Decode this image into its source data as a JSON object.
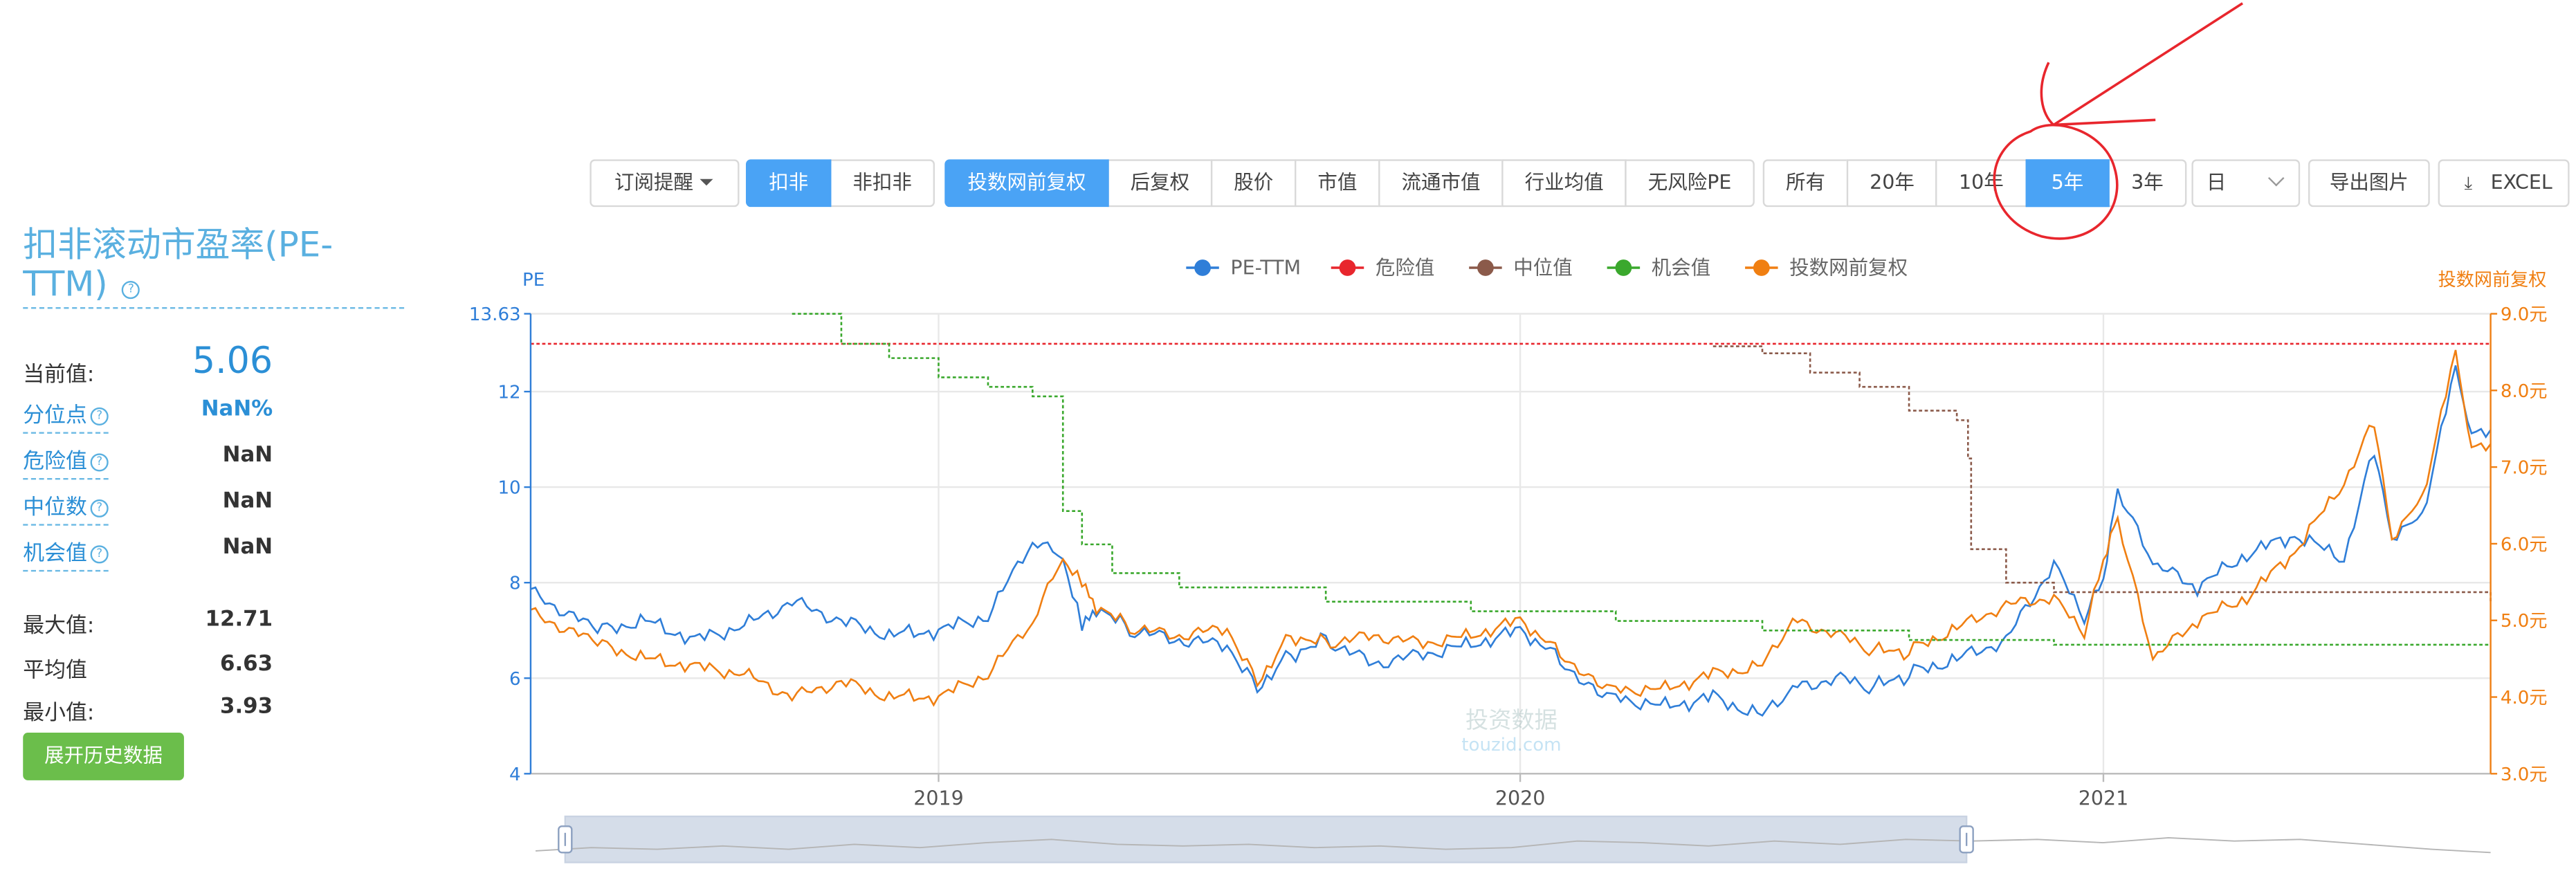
{
  "toolbar": {
    "subscribe": "订阅提醒",
    "group1": [
      "扣非",
      "非扣非"
    ],
    "group2": [
      "投数网前复权",
      "后复权",
      "股价",
      "市值",
      "流通市值",
      "行业均值",
      "无风险PE"
    ],
    "group3": [
      "所有",
      "20年",
      "10年",
      "5年",
      "3年"
    ],
    "period_select": "日",
    "export_image": "导出图片",
    "export_excel": "EXCEL"
  },
  "left_panel": {
    "title": "扣非滚动市盈率(PE-TTM)",
    "current_label": "当前值:",
    "current_value": "5.06",
    "percentile_label": "分位点",
    "percentile_value": "NaN%",
    "danger_label": "危险值",
    "danger_value": "NaN",
    "median_label": "中位数",
    "median_value": "NaN",
    "chance_label": "机会值",
    "chance_value": "NaN",
    "max_label": "最大值:",
    "max_value": "12.71",
    "avg_label": "平均值",
    "avg_value": "6.63",
    "min_label": "最小值:",
    "min_value": "3.93",
    "history_button": "展开历史数据"
  },
  "colors": {
    "pe": "#2f7ed8",
    "danger": "#e8262d",
    "median": "#8b5a4a",
    "chance": "#3aa82d",
    "price": "#f07f12",
    "active": "#4aa3f5",
    "annotation": "#e8262d"
  },
  "chart_data": {
    "type": "line",
    "title": "",
    "ylabel_left": "PE",
    "ylabel_right": "投数网前复权",
    "ylim_left": [
      4,
      13.63
    ],
    "yticks_left": [
      "4",
      "6",
      "8",
      "10",
      "12",
      "13.63"
    ],
    "ylim_right": [
      3.0,
      9.0
    ],
    "yticks_right": [
      "3.0元",
      "4.0元",
      "5.0元",
      "6.0元",
      "7.0元",
      "8.0元",
      "9.0元"
    ],
    "xlim": [
      "2018-04-20",
      "2021-09-01"
    ],
    "xticks": [
      "2019",
      "2020",
      "2021"
    ],
    "watermark": [
      "投资数据",
      "touzid.com"
    ],
    "legend": [
      "PE-TTM",
      "危险值",
      "中位值",
      "机会值",
      "投数网前复权"
    ],
    "legend_position": "top-center",
    "grid": true,
    "series": [
      {
        "name": "PE-TTM",
        "axis": "left",
        "x": [
          "2018-04-20",
          "2018-06-01",
          "2018-07-01",
          "2018-08-01",
          "2018-09-01",
          "2018-10-01",
          "2018-11-01",
          "2018-12-01",
          "2019-01-01",
          "2019-02-01",
          "2019-03-01",
          "2019-03-20",
          "2019-04-01",
          "2019-04-10",
          "2019-05-01",
          "2019-06-01",
          "2019-07-01",
          "2019-07-20",
          "2019-08-10",
          "2019-09-01",
          "2019-10-01",
          "2019-11-01",
          "2019-12-01",
          "2020-01-01",
          "2020-01-20",
          "2020-02-10",
          "2020-03-01",
          "2020-04-01",
          "2020-05-01",
          "2020-06-01",
          "2020-06-20",
          "2020-07-20",
          "2020-08-10",
          "2020-09-01",
          "2020-10-01",
          "2020-11-01",
          "2020-12-01",
          "2020-12-20",
          "2021-01-01",
          "2021-01-10",
          "2021-02-01",
          "2021-03-01",
          "2021-04-01",
          "2021-05-01",
          "2021-06-01",
          "2021-06-20",
          "2021-07-01",
          "2021-07-20",
          "2021-08-10",
          "2021-08-20",
          "2021-09-01"
        ],
        "values": [
          7.8,
          7.0,
          7.2,
          6.8,
          7.1,
          7.6,
          7.2,
          6.9,
          7.0,
          7.3,
          8.9,
          8.5,
          7.1,
          7.5,
          7.0,
          6.8,
          6.7,
          5.8,
          6.5,
          6.8,
          6.3,
          6.5,
          6.7,
          7.0,
          6.6,
          5.9,
          5.6,
          5.4,
          5.6,
          5.2,
          5.8,
          6.0,
          5.8,
          6.1,
          6.4,
          6.8,
          8.4,
          7.2,
          8.1,
          9.9,
          8.4,
          7.9,
          8.6,
          9.0,
          8.5,
          10.8,
          9.0,
          9.4,
          12.5,
          11.2,
          11.2
        ]
      },
      {
        "name": "投数网前复权",
        "axis": "right",
        "x": [
          "2018-04-20",
          "2018-06-01",
          "2018-07-01",
          "2018-08-01",
          "2018-09-01",
          "2018-10-01",
          "2018-11-01",
          "2018-12-01",
          "2019-01-01",
          "2019-02-01",
          "2019-03-01",
          "2019-03-20",
          "2019-04-01",
          "2019-04-10",
          "2019-05-01",
          "2019-06-01",
          "2019-07-01",
          "2019-07-20",
          "2019-08-10",
          "2019-09-01",
          "2019-10-01",
          "2019-11-01",
          "2019-12-01",
          "2020-01-01",
          "2020-01-20",
          "2020-02-10",
          "2020-03-01",
          "2020-04-01",
          "2020-05-01",
          "2020-06-01",
          "2020-06-20",
          "2020-07-20",
          "2020-08-10",
          "2020-09-01",
          "2020-10-01",
          "2020-11-01",
          "2020-12-01",
          "2020-12-20",
          "2021-01-01",
          "2021-01-10",
          "2021-02-01",
          "2021-03-01",
          "2021-04-01",
          "2021-05-01",
          "2021-06-01",
          "2021-06-20",
          "2021-07-01",
          "2021-07-20",
          "2021-08-10",
          "2021-08-20",
          "2021-09-01"
        ],
        "values": [
          5.1,
          4.7,
          4.5,
          4.4,
          4.3,
          4.0,
          4.2,
          4.0,
          4.0,
          4.3,
          5.0,
          5.8,
          5.5,
          5.2,
          4.9,
          4.8,
          4.9,
          4.2,
          4.8,
          4.7,
          4.8,
          4.7,
          4.8,
          5.0,
          4.7,
          4.3,
          4.1,
          4.1,
          4.3,
          4.4,
          5.0,
          4.8,
          4.6,
          4.6,
          4.9,
          5.2,
          5.3,
          4.8,
          5.8,
          6.3,
          4.5,
          5.0,
          5.3,
          5.9,
          6.8,
          7.6,
          6.1,
          6.6,
          8.5,
          7.3,
          7.3
        ]
      },
      {
        "name": "危险值",
        "axis": "left",
        "style": "dashed",
        "x": [
          "2018-04-20",
          "2021-09-01"
        ],
        "values": [
          13.0,
          13.0
        ]
      },
      {
        "name": "中位值",
        "axis": "left",
        "style": "dashed",
        "x": [
          "2020-05-01",
          "2020-06-01",
          "2020-07-01",
          "2020-08-01",
          "2020-09-01",
          "2020-10-01",
          "2020-10-08",
          "2020-10-10",
          "2020-11-01",
          "2020-12-01",
          "2021-09-01"
        ],
        "values": [
          12.95,
          12.8,
          12.4,
          12.1,
          11.6,
          11.4,
          10.6,
          8.7,
          8.0,
          7.8,
          7.6
        ]
      },
      {
        "name": "机会值",
        "axis": "left",
        "style": "dashed",
        "x": [
          "2018-10-01",
          "2018-11-01",
          "2018-12-01",
          "2019-01-01",
          "2019-02-01",
          "2019-03-01",
          "2019-03-20",
          "2019-04-01",
          "2019-04-20",
          "2019-06-01",
          "2019-09-01",
          "2019-12-01",
          "2020-03-01",
          "2020-06-01",
          "2020-09-01",
          "2020-12-01",
          "2021-09-01"
        ],
        "values": [
          13.63,
          13.0,
          12.7,
          12.3,
          12.1,
          11.9,
          9.5,
          8.8,
          8.2,
          7.9,
          7.6,
          7.4,
          7.2,
          7.0,
          6.8,
          6.7,
          6.7
        ]
      }
    ]
  }
}
